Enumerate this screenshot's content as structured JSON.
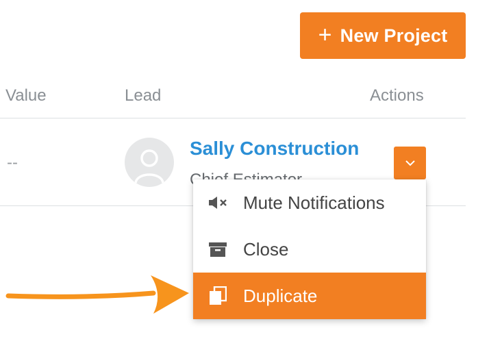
{
  "header": {
    "new_project_label": "New Project",
    "plus_symbol": "+"
  },
  "table": {
    "columns": [
      "Value",
      "Lead",
      "Actions"
    ],
    "rows": [
      {
        "value": "--",
        "lead_name": "Sally Construction",
        "lead_title": "Chief Estimator"
      }
    ]
  },
  "actions_menu": {
    "items": [
      {
        "label": "Mute Notifications",
        "icon": "mute-icon"
      },
      {
        "label": "Close",
        "icon": "archive-box-icon"
      },
      {
        "label": "Duplicate",
        "icon": "duplicate-icon",
        "highlighted": true
      }
    ]
  },
  "colors": {
    "accent_orange": "#f27f22",
    "link_blue": "#2b8fd6",
    "annotation_arrow": "#f7941d"
  }
}
